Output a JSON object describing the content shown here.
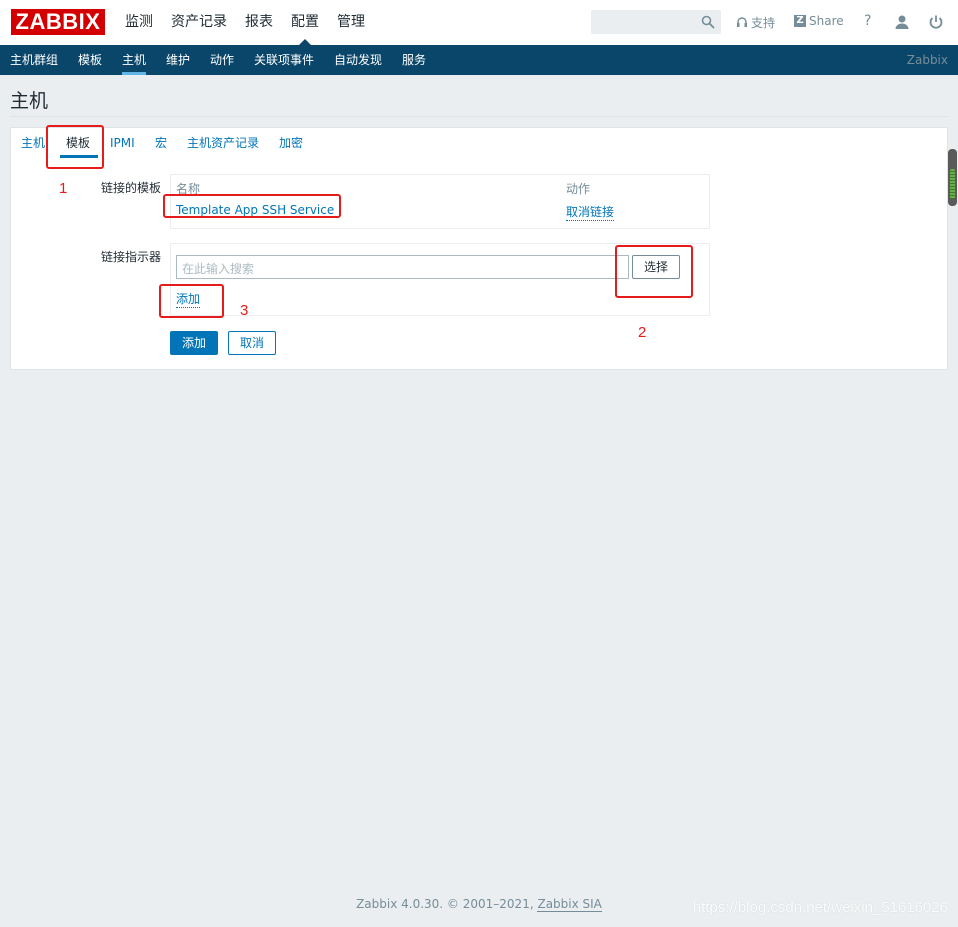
{
  "header": {
    "logo": "ZABBIX",
    "menu": [
      "监测",
      "资产记录",
      "报表",
      "配置",
      "管理"
    ],
    "search_value": "",
    "support": "支持",
    "share": "Share",
    "help": "?"
  },
  "subnav": {
    "items": [
      "主机群组",
      "模板",
      "主机",
      "维护",
      "动作",
      "关联项事件",
      "自动发现",
      "服务"
    ],
    "brand": "Zabbix"
  },
  "page": {
    "title": "主机"
  },
  "tabs": [
    "主机",
    "模板",
    "IPMI",
    "宏",
    "主机资产记录",
    "加密"
  ],
  "linked": {
    "label": "链接的模板",
    "col_name": "名称",
    "col_action": "动作",
    "template": "Template App SSH Service",
    "unlink": "取消链接"
  },
  "indicator": {
    "label": "链接指示器",
    "placeholder": "在此输入搜索",
    "select": "选择",
    "add": "添加"
  },
  "buttons": {
    "add": "添加",
    "cancel": "取消"
  },
  "annotations": [
    "1",
    "2",
    "3"
  ],
  "footer": {
    "text": "Zabbix 4.0.30. © 2001–2021, ",
    "company": "Zabbix SIA"
  },
  "watermark": "https://blog.csdn.net/weixin_51616026",
  "colors": {
    "brand_red": "#d40000",
    "nav_blue": "#0a466a",
    "link_blue": "#0275b8",
    "annotation_red": "#e61c1c"
  }
}
